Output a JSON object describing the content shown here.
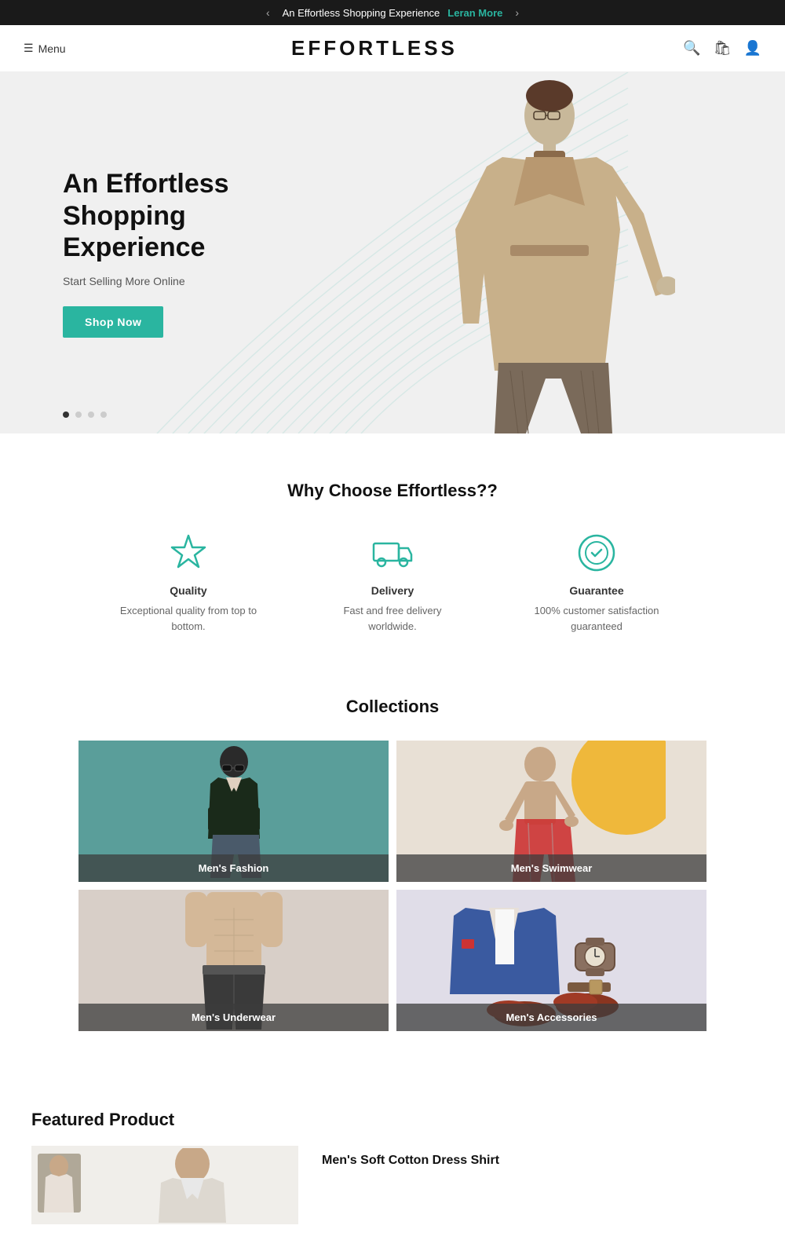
{
  "announcement": {
    "text": "An Effortless Shopping Experience",
    "link_text": "Leran More",
    "prev_arrow": "‹",
    "next_arrow": "›"
  },
  "header": {
    "menu_label": "Menu",
    "logo": "EFFORTLESS"
  },
  "hero": {
    "title_line1": "An Effortless",
    "title_line2": "Shopping Experience",
    "subtitle": "Start Selling More Online",
    "cta_label": "Shop Now",
    "dots": [
      true,
      false,
      false,
      false
    ]
  },
  "why": {
    "heading": "Why Choose Effortless??",
    "features": [
      {
        "name": "quality",
        "icon": "star",
        "title": "Quality",
        "desc": "Exceptional quality from top to bottom."
      },
      {
        "name": "delivery",
        "icon": "truck",
        "title": "Delivery",
        "desc": "Fast and free delivery worldwide."
      },
      {
        "name": "guarantee",
        "icon": "badge",
        "title": "Guarantee",
        "desc": "100% customer satisfaction guaranteed"
      }
    ]
  },
  "collections": {
    "heading": "Collections",
    "items": [
      {
        "name": "mens-fashion",
        "label": "Men's Fashion",
        "style": "fashion"
      },
      {
        "name": "mens-swimwear",
        "label": "Men's Swimwear",
        "style": "swimwear"
      },
      {
        "name": "mens-underwear",
        "label": "Men's Underwear",
        "style": "underwear"
      },
      {
        "name": "mens-accessories",
        "label": "Men's Accessories",
        "style": "accessories"
      }
    ]
  },
  "featured": {
    "heading": "Featured Product",
    "product_name": "Men's Soft Cotton Dress Shirt"
  }
}
